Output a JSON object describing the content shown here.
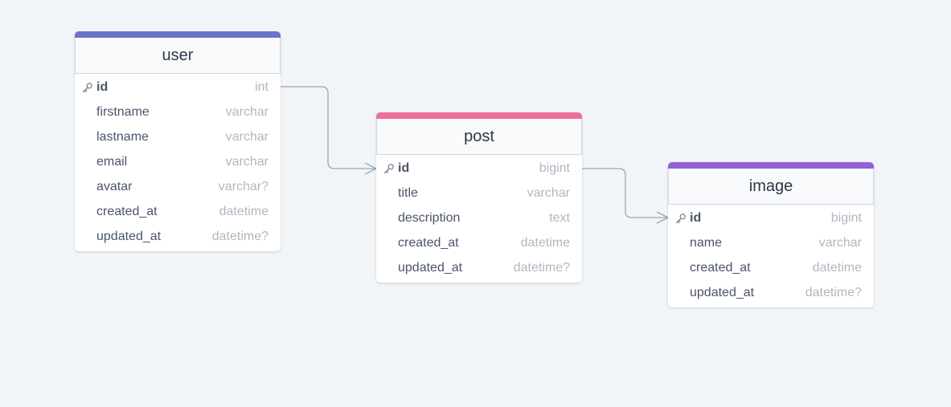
{
  "colors": {
    "background": "#f1f5f8",
    "connector": "#9aa6b6",
    "user_accent": "#6b74c9",
    "post_accent": "#ee6e9b",
    "image_accent": "#9361d9"
  },
  "icons": {
    "primary_key": "key-icon",
    "relation_many": "crow-foot-icon"
  },
  "tables": {
    "user": {
      "name": "user",
      "fields": [
        {
          "name": "id",
          "type": "int",
          "pk": true
        },
        {
          "name": "firstname",
          "type": "varchar"
        },
        {
          "name": "lastname",
          "type": "varchar"
        },
        {
          "name": "email",
          "type": "varchar"
        },
        {
          "name": "avatar",
          "type": "varchar?"
        },
        {
          "name": "created_at",
          "type": "datetime"
        },
        {
          "name": "updated_at",
          "type": "datetime?"
        }
      ]
    },
    "post": {
      "name": "post",
      "fields": [
        {
          "name": "id",
          "type": "bigint",
          "pk": true
        },
        {
          "name": "title",
          "type": "varchar"
        },
        {
          "name": "description",
          "type": "text"
        },
        {
          "name": "created_at",
          "type": "datetime"
        },
        {
          "name": "updated_at",
          "type": "datetime?"
        }
      ]
    },
    "image": {
      "name": "image",
      "fields": [
        {
          "name": "id",
          "type": "bigint",
          "pk": true
        },
        {
          "name": "name",
          "type": "varchar"
        },
        {
          "name": "created_at",
          "type": "datetime"
        },
        {
          "name": "updated_at",
          "type": "datetime?"
        }
      ]
    }
  },
  "relations": [
    {
      "from": "user.id",
      "to": "post.id",
      "cardinality": "one-to-many"
    },
    {
      "from": "post.id",
      "to": "image.id",
      "cardinality": "one-to-many"
    }
  ]
}
